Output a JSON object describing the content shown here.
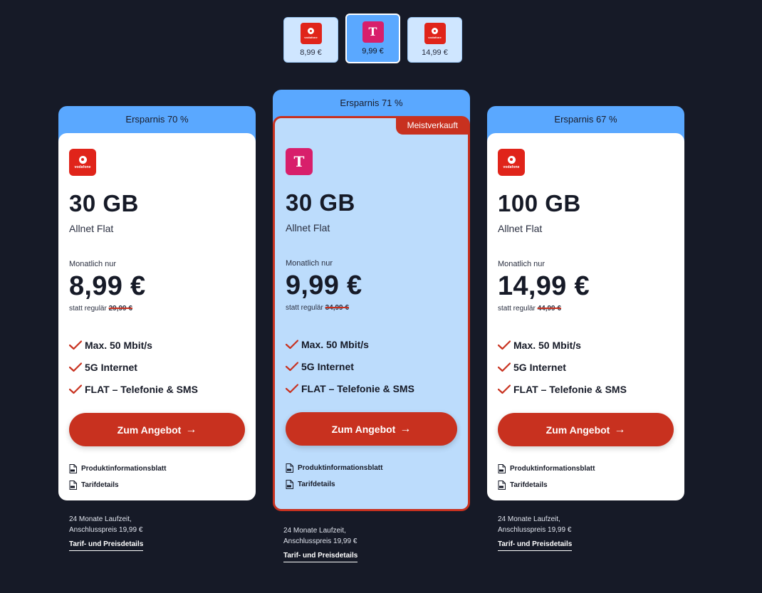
{
  "selector": [
    {
      "brand": "vodafone",
      "price": "8,99 €",
      "active": false
    },
    {
      "brand": "telekom",
      "price": "9,99 €",
      "active": true
    },
    {
      "brand": "vodafone",
      "price": "14,99 €",
      "active": false
    }
  ],
  "logos": {
    "vodafone_word": "vodafone",
    "telekom_mark": "T"
  },
  "icons": {
    "check": "checkmark-icon",
    "arrow": "arrow-right-icon",
    "pdf": "pdf-file-icon"
  },
  "colors": {
    "background": "#161a27",
    "accent_blue": "#5aa8ff",
    "cta_red": "#c8311f",
    "featured_bg": "#bcdcfc"
  },
  "cards": [
    {
      "savings": "Ersparnis 70 %",
      "data": "30 GB",
      "tariff": "Allnet Flat",
      "monthly_label": "Monatlich nur",
      "price": "8,99 €",
      "regular_prefix": "statt regulär",
      "regular_price": "29,99 €",
      "features": [
        "Max. 50 Mbit/s",
        "5G Internet",
        "FLAT – Telefonie & SMS"
      ],
      "cta": "Zum Angebot",
      "links": [
        "Produktinformationsblatt",
        "Tarifdetails"
      ],
      "foot_1": "24 Monate Laufzeit,",
      "foot_2": "Anschlusspreis 19,99 €",
      "foot_link": "Tarif- und Preisdetails"
    },
    {
      "savings": "Ersparnis 71 %",
      "badge": "Meistverkauft",
      "data": "30 GB",
      "tariff": "Allnet Flat",
      "monthly_label": "Monatlich nur",
      "price": "9,99 €",
      "regular_prefix": "statt regulär",
      "regular_price": "34,99 €",
      "features": [
        "Max. 50 Mbit/s",
        "5G Internet",
        "FLAT – Telefonie & SMS"
      ],
      "cta": "Zum Angebot",
      "links": [
        "Produktinformationsblatt",
        "Tarifdetails"
      ],
      "foot_1": "24 Monate Laufzeit,",
      "foot_2": "Anschlusspreis 19,99 €",
      "foot_link": "Tarif- und Preisdetails"
    },
    {
      "savings": "Ersparnis 67 %",
      "data": "100 GB",
      "tariff": "Allnet Flat",
      "monthly_label": "Monatlich nur",
      "price": "14,99 €",
      "regular_prefix": "statt regulär",
      "regular_price": "44,99 €",
      "features": [
        "Max. 50 Mbit/s",
        "5G Internet",
        "FLAT – Telefonie & SMS"
      ],
      "cta": "Zum Angebot",
      "links": [
        "Produktinformationsblatt",
        "Tarifdetails"
      ],
      "foot_1": "24 Monate Laufzeit,",
      "foot_2": "Anschlusspreis 19,99 €",
      "foot_link": "Tarif- und Preisdetails"
    }
  ]
}
